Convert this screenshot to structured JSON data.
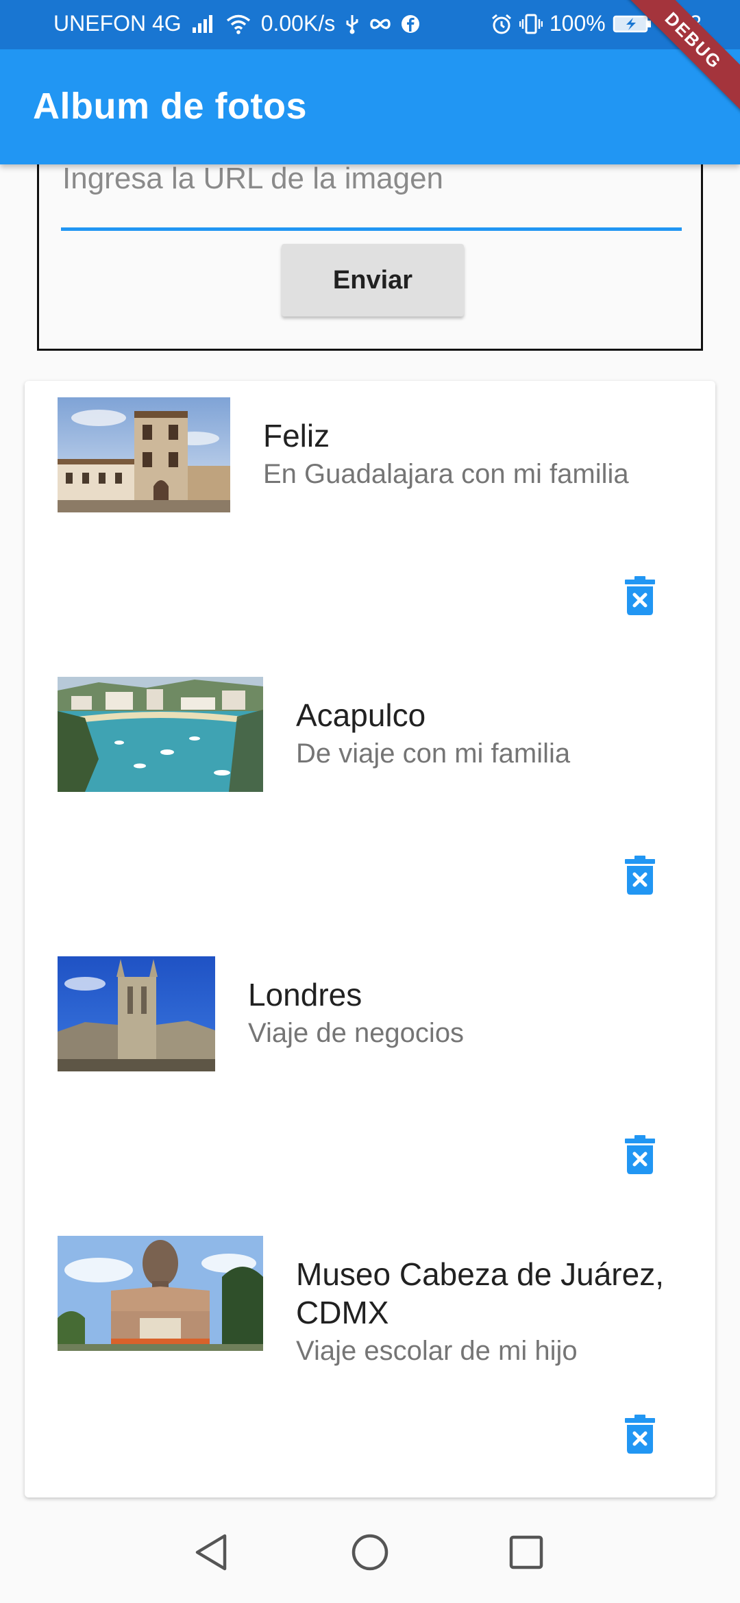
{
  "status_bar": {
    "carrier": "UNEFON 4G",
    "speed": "0.00K/s",
    "battery": "100%",
    "time": "3:43"
  },
  "app_bar": {
    "title": "Album de fotos"
  },
  "debug_banner": "DEBUG",
  "form": {
    "url_placeholder": "Ingresa la URL de la imagen",
    "send_label": "Enviar"
  },
  "photos": [
    {
      "title": "Feliz",
      "subtitle": "En Guadalajara con mi familia"
    },
    {
      "title": "Acapulco",
      "subtitle": "De viaje con mi familia"
    },
    {
      "title": "Londres",
      "subtitle": "Viaje de negocios"
    },
    {
      "title": "Museo Cabeza de Juárez, CDMX",
      "subtitle": "Viaje escolar de mi hijo"
    }
  ],
  "colors": {
    "status_bar": "#1976d2",
    "app_bar": "#2196f3",
    "accent": "#2196f3",
    "debug_banner": "#a4343c"
  }
}
